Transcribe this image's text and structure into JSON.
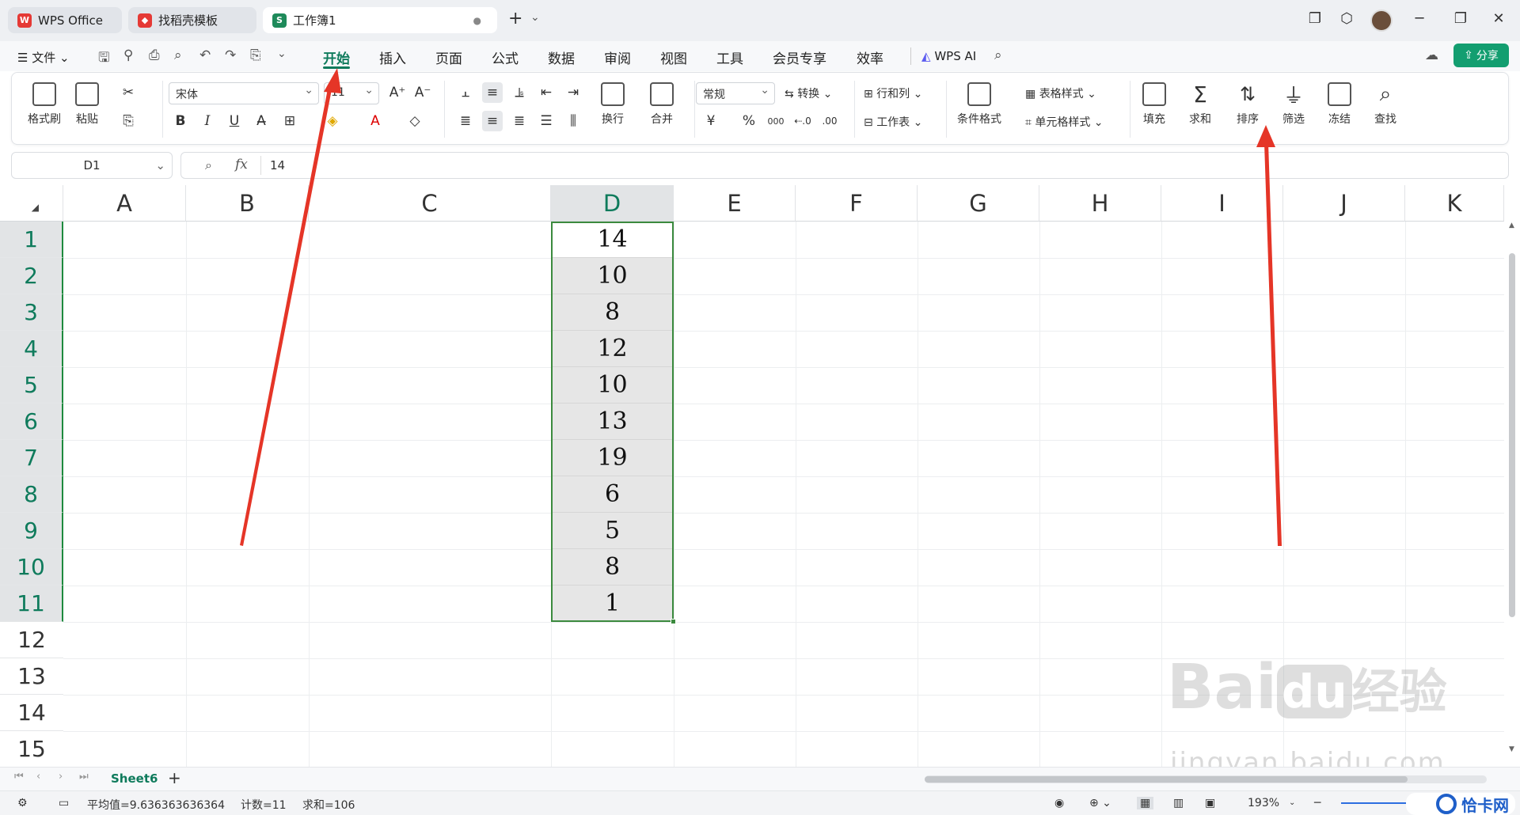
{
  "tabs": [
    {
      "label": "WPS Office",
      "icon": "wps-logo-icon",
      "color": "#e53935"
    },
    {
      "label": "找稻壳模板",
      "icon": "docer-icon",
      "color": "#e53935"
    },
    {
      "label": "工作簿1",
      "icon": "sheet-icon",
      "color": "#1e8a5a",
      "badge": "S"
    }
  ],
  "menubar": {
    "file": "文件",
    "items": [
      "开始",
      "插入",
      "页面",
      "公式",
      "数据",
      "审阅",
      "视图",
      "工具",
      "会员专享",
      "效率"
    ],
    "active": "开始",
    "ai": "WPS AI",
    "share": "分享"
  },
  "ribbon": {
    "format_painter": "格式刷",
    "paste": "粘贴",
    "font_name": "宋体",
    "font_size": "11",
    "bold": "B",
    "italic": "I",
    "underline": "U",
    "wrap": "换行",
    "merge": "合并",
    "number_format": "常规",
    "convert": "转换",
    "rows_cols": "行和列",
    "worksheet": "工作表",
    "cond_format": "条件格式",
    "table_style": "表格样式",
    "cell_style": "单元格样式",
    "fill": "填充",
    "sum": "求和",
    "sort": "排序",
    "filter": "筛选",
    "freeze": "冻结",
    "find": "查找",
    "currency": "¥",
    "percent": "%",
    "thousands": "000"
  },
  "formula": {
    "name_box": "D1",
    "fx": "fx",
    "value": "14"
  },
  "grid": {
    "columns": [
      "A",
      "B",
      "C",
      "D",
      "E",
      "F",
      "G",
      "H",
      "I",
      "J",
      "K"
    ],
    "rows": [
      "1",
      "2",
      "3",
      "4",
      "5",
      "6",
      "7",
      "8",
      "9",
      "10",
      "11",
      "12",
      "13",
      "14",
      "15"
    ],
    "selected_col": "D",
    "d_values": [
      "14",
      "10",
      "8",
      "12",
      "10",
      "13",
      "19",
      "6",
      "5",
      "8",
      "1"
    ]
  },
  "sheet": {
    "name": "Sheet6",
    "add": "+"
  },
  "status": {
    "average": "平均值=9.636363636364",
    "count": "计数=11",
    "sum": "求和=106",
    "zoom": "193%"
  },
  "watermark": {
    "text1": "Bai",
    "text2": "du",
    "text3": "经验",
    "url": "jingyan.baidu.com",
    "corner": "恰卡网"
  },
  "colors": {
    "accent": "#0f7b5c",
    "selection": "#3b8a3e",
    "arrow": "#e53527"
  }
}
